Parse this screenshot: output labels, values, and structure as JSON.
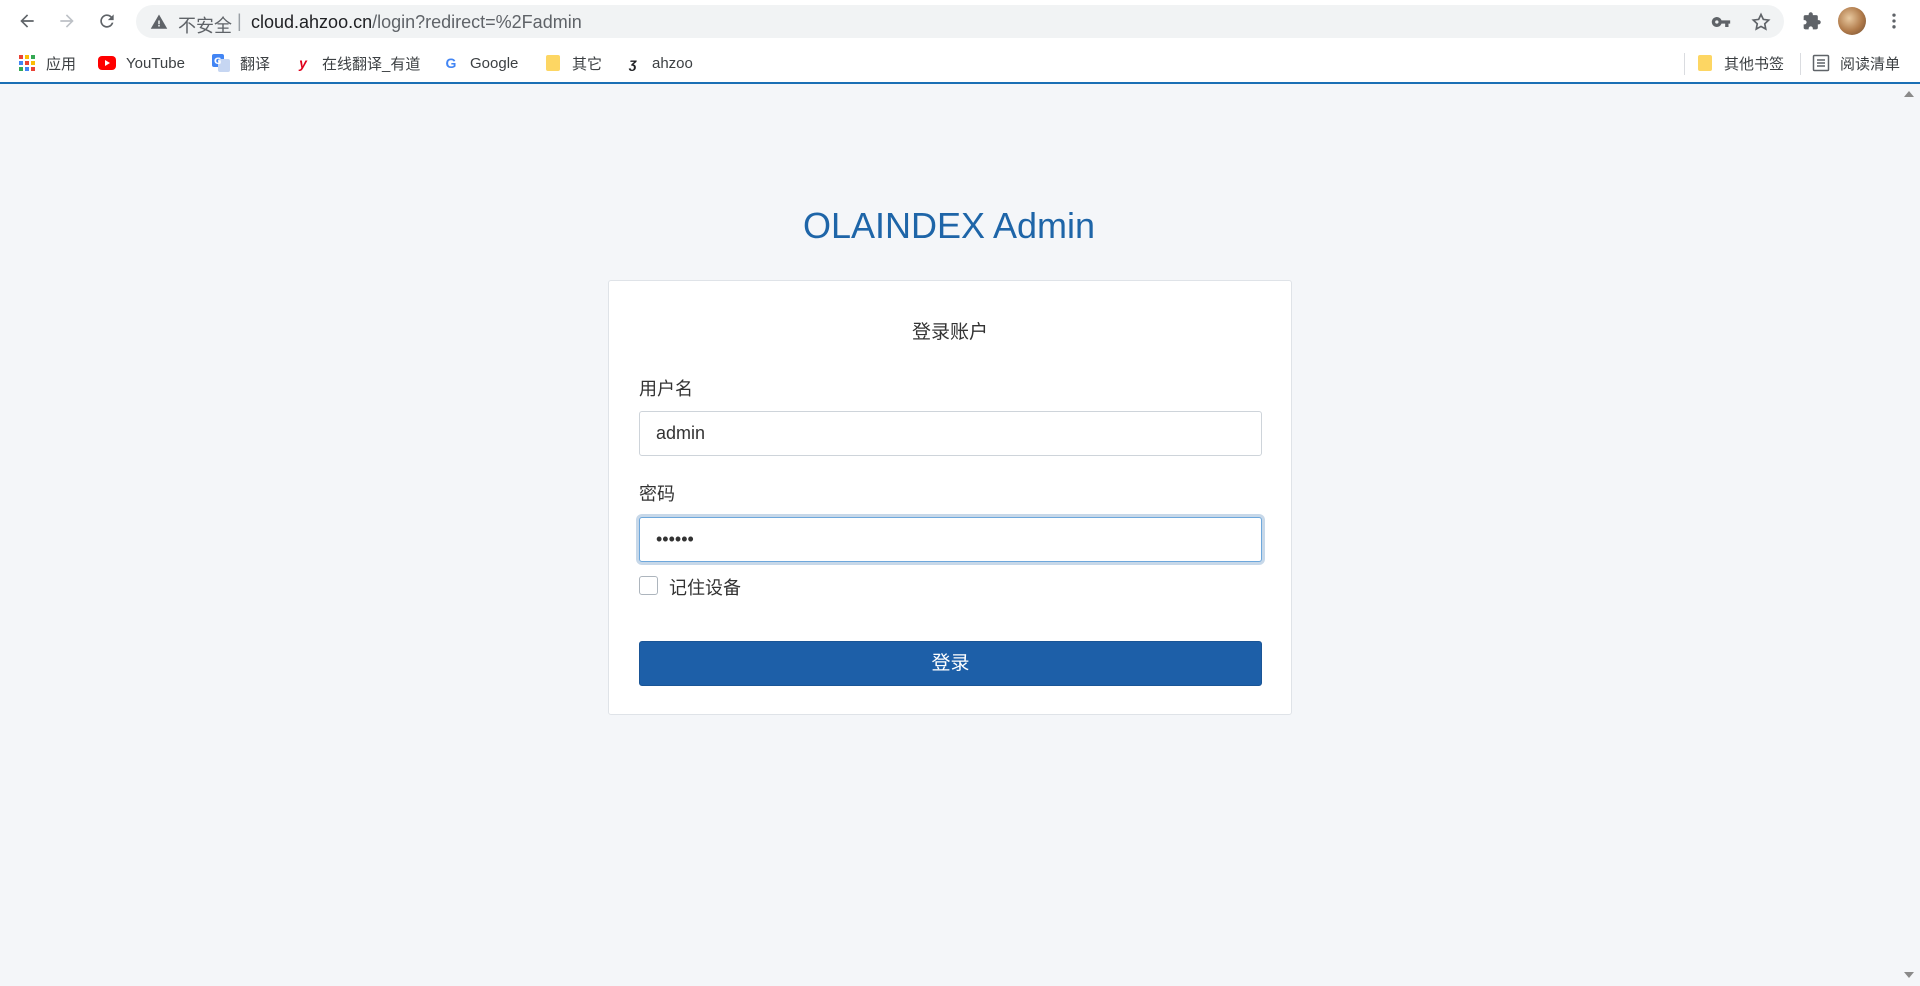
{
  "browser": {
    "address_insecure_label": "不安全",
    "address_separator": "|",
    "address_host": "cloud.ahzoo.cn",
    "address_path": "/login?redirect=%2Fadmin"
  },
  "bookmarks": {
    "items": [
      {
        "label": "应用",
        "icon": "apps-grid-icon"
      },
      {
        "label": "YouTube",
        "icon": "youtube-icon"
      },
      {
        "label": "翻译",
        "icon": "translate-icon"
      },
      {
        "label": "在线翻译_有道",
        "icon": "youdao-icon"
      },
      {
        "label": "Google",
        "icon": "google-icon"
      },
      {
        "label": "其它",
        "icon": "folder-icon"
      },
      {
        "label": "ahzoo",
        "icon": "ahzoo-icon"
      }
    ],
    "other_bookmarks": "其他书签",
    "reading_list": "阅读清单"
  },
  "page": {
    "title": "OLAINDEX Admin",
    "card_title": "登录账户",
    "username_label": "用户名",
    "username_value": "admin",
    "password_label": "密码",
    "password_value": "••••••",
    "remember_label": "记住设备",
    "submit_label": "登录"
  },
  "colors": {
    "brand": "#1e65a8",
    "button": "#1d5fa8",
    "page_bg": "#f4f6f9"
  }
}
